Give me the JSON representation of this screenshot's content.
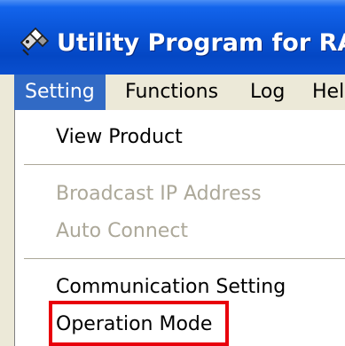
{
  "window": {
    "title": "Utility Program for RA",
    "icon": "app-icon"
  },
  "menubar": {
    "items": [
      {
        "label": "Setting",
        "active": true
      },
      {
        "label": "Functions"
      },
      {
        "label": "Log"
      },
      {
        "label": "Hel"
      }
    ]
  },
  "dropdown": {
    "items": [
      {
        "label": "View Product",
        "enabled": true
      },
      {
        "label": "Broadcast IP Address",
        "enabled": false
      },
      {
        "label": "Auto Connect",
        "enabled": false
      },
      {
        "label": "Communication Setting",
        "enabled": true
      },
      {
        "label": "Operation Mode",
        "enabled": true,
        "highlighted": true
      }
    ]
  },
  "colors": {
    "titlebar_blue": "#0a55d8",
    "menu_selected": "#316ac5",
    "disabled_text": "#aca899",
    "highlight_border": "#e8000c"
  }
}
